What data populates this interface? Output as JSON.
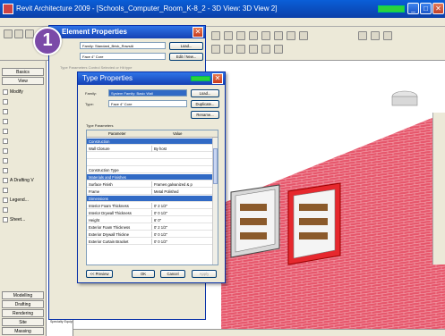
{
  "app": {
    "title": "Revit Architecture 2009 - [Schools_Computer_Room_K-8_2 - 3D View: 3D View 2]"
  },
  "badge": {
    "number": "1"
  },
  "design_bar": {
    "tabs_top": [
      "Basics",
      "View"
    ],
    "items": [
      {
        "label": "Modify",
        "active": true
      },
      {
        "label": "",
        "active": false
      },
      {
        "label": "",
        "active": false
      },
      {
        "label": "",
        "active": false
      },
      {
        "label": "",
        "active": false
      },
      {
        "label": "",
        "active": false
      },
      {
        "label": "",
        "active": false
      },
      {
        "label": "",
        "active": false
      },
      {
        "label": "",
        "active": false
      },
      {
        "label": "A Drafting V",
        "active": true
      },
      {
        "label": "",
        "active": false
      },
      {
        "label": "Legend...",
        "active": true
      },
      {
        "label": "",
        "active": false
      },
      {
        "label": "Sheet...",
        "active": true
      }
    ],
    "tabs_bottom": [
      "Modelling",
      "Drafting",
      "Rendering",
      "Site",
      "Massing"
    ]
  },
  "browser": {
    "rows": [
      "Ceilings",
      "Curtain P",
      "Curtain S",
      "Curtain W",
      "Detail Ite",
      "Doors",
      "Duct",
      "Electrical",
      "Floors",
      "Furniture",
      "Generic Model",
      "Lighting Fixtures",
      "Mechanical Eq",
      "Profiles",
      "Railings",
      "Ramps",
      "Roofs",
      "Specialty Equip"
    ]
  },
  "element_dialog": {
    "title": "Element Properties",
    "family_value": "Family: Standard_Brick_RowsAl",
    "type_value": "Face 4\" Core",
    "load_label": "Load...",
    "edit_label": "Edit / New...",
    "section_label": "Type Parameters Control Selected or Hit type"
  },
  "type_dialog": {
    "title": "Type Properties",
    "family_label": "Family:",
    "family_value": "System Family: Basic Wall",
    "type_label": "Type:",
    "type_value": "Face 4\" Core",
    "load_label": "Load...",
    "duplicate_label": "Duplicate...",
    "rename_label": "Rename...",
    "section_label": "Type Parameters",
    "col_parameter": "Parameter",
    "col_value": "Value",
    "rows": [
      {
        "name": "Construction",
        "value": "",
        "group": true
      },
      {
        "name": "Wall Closure",
        "value": "By host",
        "group": false
      },
      {
        "name": "",
        "value": "",
        "group": false
      },
      {
        "name": "",
        "value": "",
        "group": false
      },
      {
        "name": "Construction Type",
        "value": "",
        "group": false
      },
      {
        "name": "Materials and Finishes",
        "value": "",
        "group": true
      },
      {
        "name": "Surface Finish",
        "value": "Frames galvanized & p",
        "group": false
      },
      {
        "name": "Frame",
        "value": "Metal Polished",
        "group": false
      },
      {
        "name": "Dimensions",
        "value": "",
        "group": true
      },
      {
        "name": "Interior Foam Thickness",
        "value": "0'  2 1/2\"",
        "group": false
      },
      {
        "name": "Interior Drywall Thickness",
        "value": "0'  0 1/2\"",
        "group": false
      },
      {
        "name": "Height",
        "value": "6'  0\"",
        "group": false
      },
      {
        "name": "Exterior Foam Thickness",
        "value": "0'  2 1/2\"",
        "group": false
      },
      {
        "name": "Exterior Drywall Thickne",
        "value": "0'  0 1/2\"",
        "group": false
      },
      {
        "name": "Exterior Curtain Bracket",
        "value": "0'  0 1/2\"",
        "group": false
      }
    ],
    "preview_label": "<< Preview",
    "ok_label": "OK",
    "cancel_label": "Cancel",
    "apply_label": "Apply"
  },
  "colors": {
    "brick": "#e6566b",
    "brick_mortar": "#f1a3ae",
    "title_bar": "#1541b4",
    "selection": "#316ac5"
  }
}
